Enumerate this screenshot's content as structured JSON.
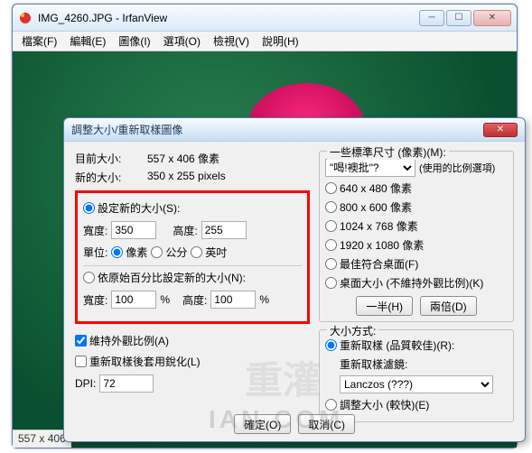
{
  "window": {
    "title": "IMG_4260.JPG - IrfanView",
    "menu": [
      "檔案(F)",
      "編輯(E)",
      "圖像(I)",
      "選項(O)",
      "檢視(V)",
      "說明(H)"
    ],
    "status": "557 x 406"
  },
  "dialog": {
    "title": "調整大小/重新取樣圖像",
    "current_label": "目前大小:",
    "current_value": "557 x 406 像素",
    "new_label": "新的大小:",
    "new_value": "350 x 255 pixels",
    "set_new_size": "設定新的大小(S):",
    "width_label": "寬度:",
    "width_value": "350",
    "height_label": "高度:",
    "height_value": "255",
    "unit_label": "單位:",
    "unit_px": "像素",
    "unit_cm": "公分",
    "unit_in": "英吋",
    "by_percent": "依原始百分比設定新的大小(N):",
    "pct_w_label": "寬度:",
    "pct_w_value": "100",
    "pct_h_label": "高度:",
    "pct_h_value": "100",
    "pct_sym": "%",
    "keep_ratio": "維持外觀比例(A)",
    "sharpen": "重新取樣後套用銳化(L)",
    "dpi_label": "DPI:",
    "dpi_value": "72",
    "std_title": "一些標準尺寸 (像素)(M):",
    "std_select": "\"喝!襖批\"?",
    "std_hint": "(使用的比例選項)",
    "std_640": "640 x 480 像素",
    "std_800": "800 x 600 像素",
    "std_1024": "1024 x 768 像素",
    "std_1920": "1920 x 1080 像素",
    "std_desktop": "最佳符合桌面(F)",
    "std_desktop2": "桌面大小 (不維持外觀比例)(K)",
    "half_btn": "一半(H)",
    "double_btn": "兩倍(D)",
    "method_title": "大小方式:",
    "method_resample": "重新取樣 (品質較佳)(R):",
    "filter_label": "重新取樣濾鏡:",
    "filter_value": "Lanczos (???)",
    "method_resize": "調整大小 (較快)(E)",
    "ok_btn": "確定(O)",
    "cancel_btn": "取消(C)"
  }
}
